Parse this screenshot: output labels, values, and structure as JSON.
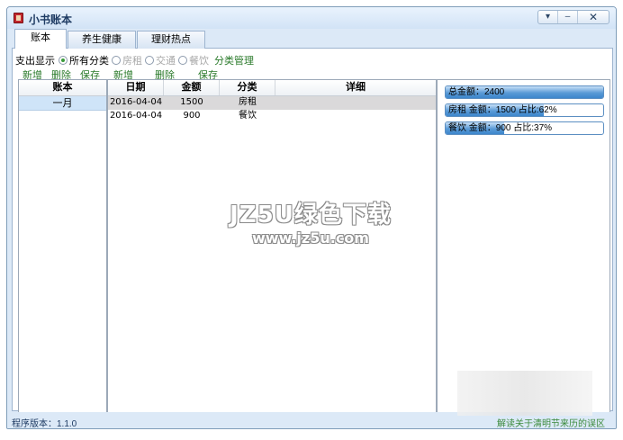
{
  "window": {
    "title": "小书账本",
    "btn_menu": "▾",
    "btn_min": "–",
    "btn_close": "✕"
  },
  "tabs": [
    {
      "label": "账本",
      "active": true
    },
    {
      "label": "养生健康",
      "active": false
    },
    {
      "label": "理财热点",
      "active": false
    }
  ],
  "filter": {
    "label": "支出显示",
    "options": [
      {
        "label": "所有分类",
        "checked": true
      },
      {
        "label": "房租",
        "checked": false
      },
      {
        "label": "交通",
        "checked": false
      },
      {
        "label": "餐饮",
        "checked": false
      }
    ],
    "manage": "分类管理"
  },
  "left_toolbar": {
    "add": "新增",
    "delete": "删除",
    "save": "保存"
  },
  "mid_toolbar": {
    "add": "新增",
    "delete": "删除",
    "save": "保存"
  },
  "books": {
    "header": "账本",
    "items": [
      "一月"
    ]
  },
  "table": {
    "headers": {
      "date": "日期",
      "amount": "金额",
      "category": "分类",
      "detail": "详细"
    },
    "rows": [
      {
        "date": "2016-04-04",
        "amount": "1500",
        "category": "房租",
        "detail": ""
      },
      {
        "date": "2016-04-04",
        "amount": "900",
        "category": "餐饮",
        "detail": ""
      }
    ]
  },
  "stats": [
    {
      "text": "总金额：2400",
      "fill": 1.0
    },
    {
      "text": "房租 金额：1500 占比:62%",
      "fill": 0.62
    },
    {
      "text": "餐饮 金额：900 占比:37%",
      "fill": 0.37
    }
  ],
  "status": {
    "version": "程序版本：1.1.0",
    "link": "解读关于清明节来历的误区"
  },
  "watermark": {
    "line1": "JZ5U绿色下载",
    "line2": "www.jz5u.com"
  }
}
